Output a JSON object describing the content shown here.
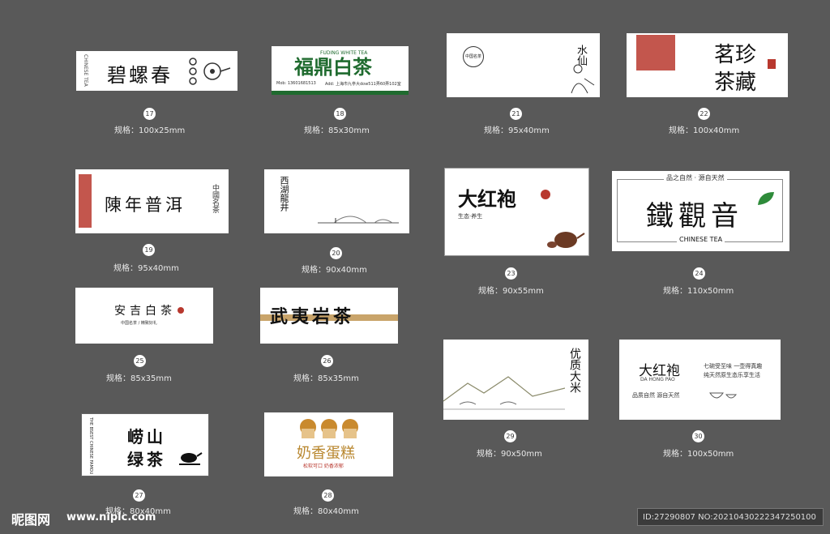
{
  "cards": {
    "c17": {
      "num": "17",
      "spec": "规格：100x25mm",
      "title": "碧螺春",
      "side": "CHINESE TEA"
    },
    "c18": {
      "num": "18",
      "spec": "规格：85x30mm",
      "title": "福鼎白茶",
      "en": "FUDING WHITE TEA",
      "mob": "Mob: 13601681513",
      "addr": "Add: 上海市九亭大dow511弄60弄102室"
    },
    "c21": {
      "num": "21",
      "spec": "规格：95x40mm",
      "title": "水仙",
      "tag": "中国名茶"
    },
    "c22": {
      "num": "22",
      "spec": "规格：100x40mm",
      "title1": "茗珍",
      "title2": "茶藏"
    },
    "c19": {
      "num": "19",
      "spec": "规格：95x40mm",
      "title": "陳年普洱",
      "side": "中國名茶"
    },
    "c20": {
      "num": "20",
      "spec": "规格：90x40mm",
      "title": "西湖龍井"
    },
    "c23": {
      "num": "23",
      "spec": "规格：90x55mm",
      "title": "大红袍",
      "sub": "生态·养生"
    },
    "c24": {
      "num": "24",
      "spec": "规格：110x50mm",
      "top": "品之自然 · 源自天然",
      "title": "鐵觀音",
      "en": "CHINESE TEA"
    },
    "c25": {
      "num": "25",
      "spec": "规格：85x35mm",
      "title": "安吉白茶",
      "sub": "中国名茶 / 精致好礼"
    },
    "c26": {
      "num": "26",
      "spec": "规格：85x35mm",
      "title": "武夷岩茶"
    },
    "c29": {
      "num": "29",
      "spec": "规格：90x50mm",
      "title": "优质大米"
    },
    "c30": {
      "num": "30",
      "spec": "规格：100x50mm",
      "title": "大红袍",
      "en": "DA HONG PAO",
      "line1": "七碗受至味 一壶得真趣",
      "line2": "纯天然原生态乐享生活",
      "sub": "品质自然 源自天然"
    },
    "c27": {
      "num": "27",
      "spec": "规格：80x40mm",
      "title1": "崂山",
      "title2": "绿茶",
      "side": "THE BSEST CHINESE FAMOUS TEA"
    },
    "c28": {
      "num": "28",
      "spec": "规格：80x40mm",
      "title": "奶香蛋糕",
      "sub": "松软可口 奶香浓郁"
    }
  },
  "footer": {
    "logo": "昵图网",
    "url": "www.nipic.com",
    "id": "ID:27290807 NO:20210430222347250100"
  },
  "colors": {
    "background": "#595959",
    "green": "#1f6b2f",
    "seal": "#b8382e",
    "gold": "#b8862d"
  }
}
